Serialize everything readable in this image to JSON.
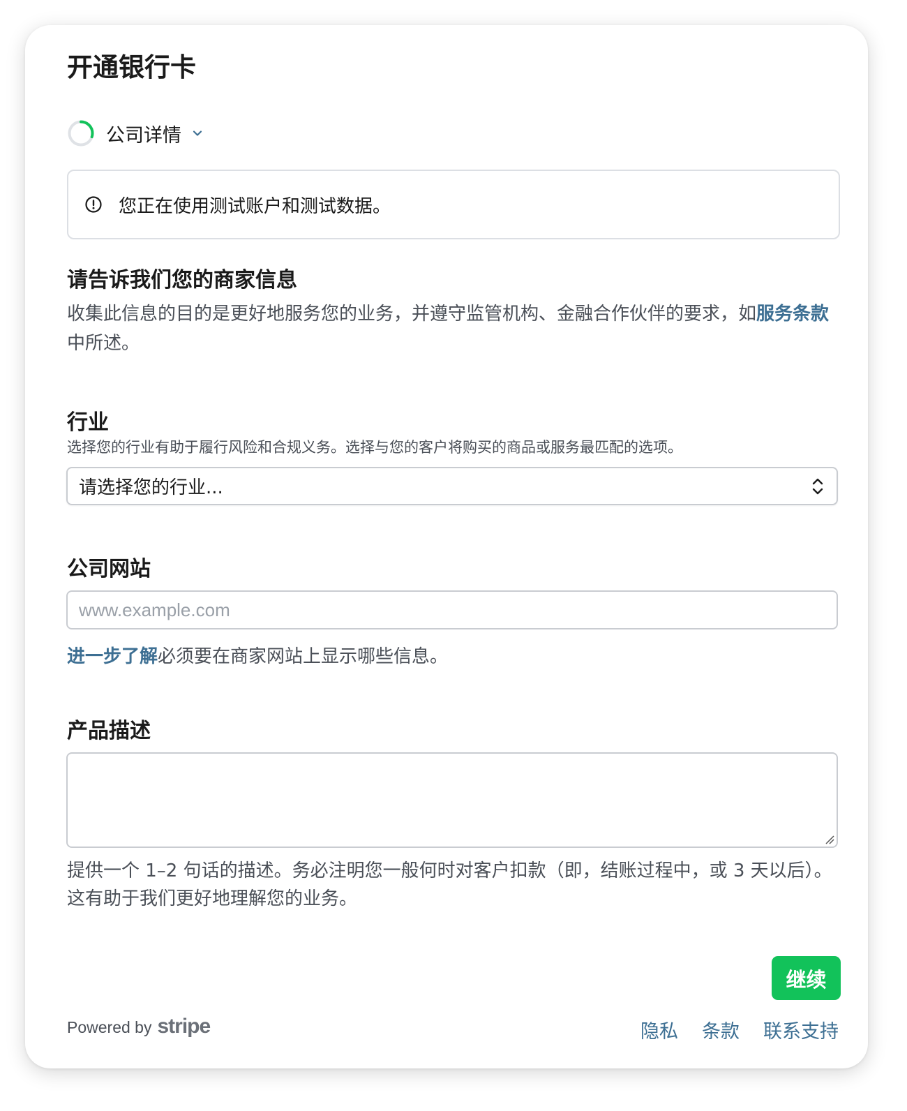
{
  "page": {
    "title": "开通银行卡"
  },
  "stepper": {
    "label": "公司详情",
    "progress": 0.3,
    "accent": "#12c25a"
  },
  "notice": {
    "text": "您正在使用测试账户和测试数据。",
    "icon": "info-circle-icon"
  },
  "business_info": {
    "heading": "请告诉我们您的商家信息",
    "desc_before": "收集此信息的目的是更好地服务您的业务，并遵守监管机构、金融合作伙伴的要求，如",
    "desc_link": "服务条款",
    "desc_after": "中所述。"
  },
  "industry": {
    "label": "行业",
    "hint": "选择您的行业有助于履行风险和合规义务。选择与您的客户将购买的商品或服务最匹配的选项。",
    "selected": "请选择您的行业..."
  },
  "website": {
    "label": "公司网站",
    "placeholder": "www.example.com",
    "value": "",
    "help_link": "进一步了解",
    "help_text": "必须要在商家网站上显示哪些信息。"
  },
  "product": {
    "label": "产品描述",
    "value": "",
    "help": "提供一个 1–2 句话的描述。务必注明您一般何时对客户扣款（即，结账过程中，或 3 天以后）。这有助于我们更好地理解您的业务。"
  },
  "actions": {
    "continue_label": "继续",
    "continue_color": "#12c25a"
  },
  "footer": {
    "powered_by": "Powered by",
    "brand": "stripe",
    "links": [
      "隐私",
      "条款",
      "联系支持"
    ],
    "link_color": "#3d6f93"
  }
}
